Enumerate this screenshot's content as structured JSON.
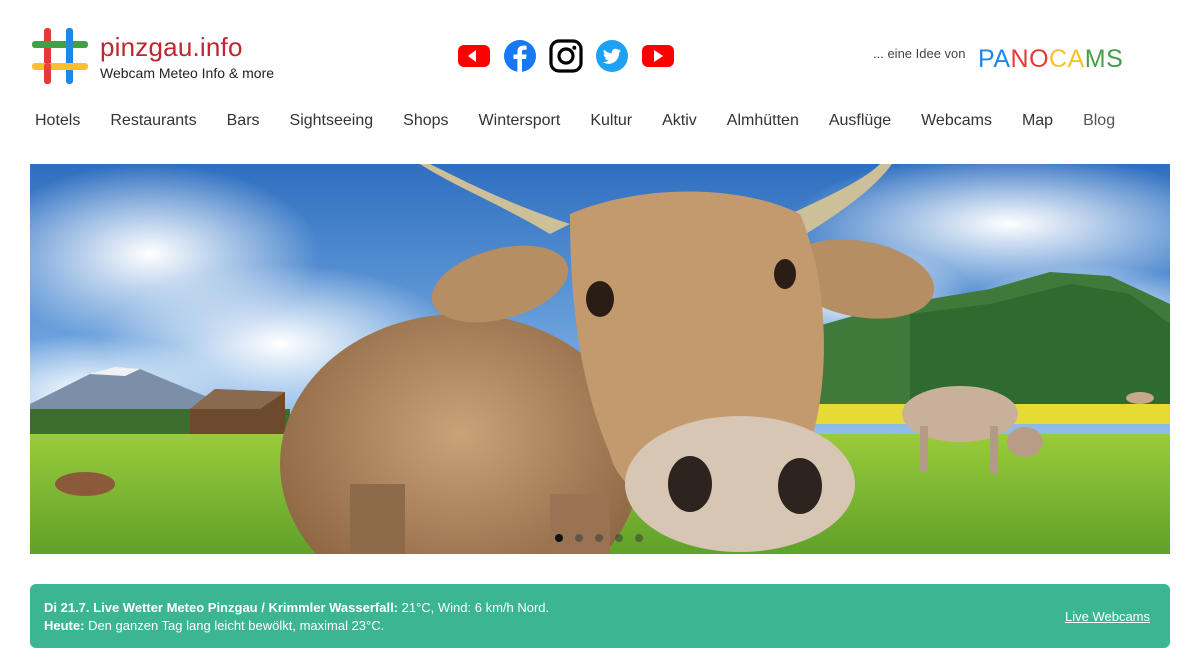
{
  "header": {
    "site_name": "pinzgau.info",
    "tagline": "Webcam Meteo Info & more",
    "idea_prefix": "... eine Idee von",
    "panocams": {
      "letters": [
        "P",
        "A",
        "N",
        "O",
        "C",
        "A",
        "M",
        "S"
      ],
      "colors": [
        "#1e88e5",
        "#1e88e5",
        "#e53935",
        "#e53935",
        "#fbc02d",
        "#fbc02d",
        "#43a047",
        "#43a047"
      ]
    },
    "social": [
      "youtube-icon",
      "facebook-icon",
      "instagram-icon",
      "twitter-icon",
      "youtube-icon"
    ]
  },
  "nav": {
    "items": [
      "Hotels",
      "Restaurants",
      "Bars",
      "Sightseeing",
      "Shops",
      "Wintersport",
      "Kultur",
      "Aktiv",
      "Almhütten",
      "Ausflüge",
      "Webcams",
      "Map",
      "Blog"
    ]
  },
  "hero": {
    "slide_count": 5,
    "active_slide": 1
  },
  "weather": {
    "date": "Di 21.7.",
    "title": "Live Wetter Meteo Pinzgau / Krimmler Wasserfall:",
    "current": " 21°C, Wind: 6 km/h Nord.",
    "today_label": "Heute:",
    "today_text": " Den ganzen Tag lang leicht bewölkt, maximal 23°C.",
    "link_label": "Live Webcams"
  },
  "colors": {
    "brand_red": "#c0262d",
    "weather_bar": "#3bb592",
    "youtube_red": "#ff0000",
    "facebook_blue": "#1877f2",
    "twitter_blue": "#1da1f2"
  }
}
